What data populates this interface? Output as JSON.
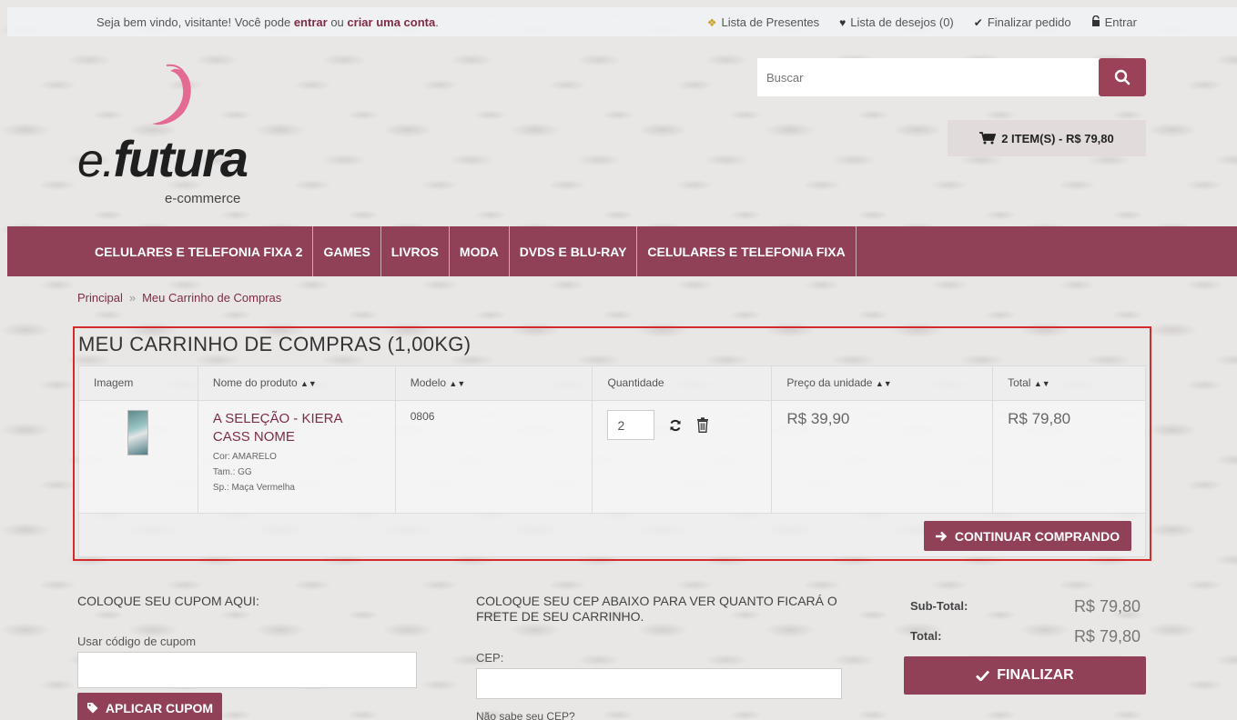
{
  "topbar": {
    "welcome_prefix": "Seja bem vindo, visitante! Você pode",
    "login_link": "entrar",
    "or": "ou",
    "register_link": "criar uma conta",
    "end": ".",
    "links": [
      {
        "icon": "gift-icon",
        "label": "Lista de Presentes"
      },
      {
        "icon": "heart-icon",
        "label": "Lista de desejos (0)"
      },
      {
        "icon": "check-icon",
        "label": "Finalizar pedido"
      },
      {
        "icon": "lock-icon",
        "label": "Entrar"
      }
    ]
  },
  "logo": {
    "brand_prefix": "e.",
    "brand_name": "futura",
    "subtitle": "e-commerce"
  },
  "search": {
    "placeholder": "Buscar"
  },
  "cart_button": {
    "label": "2 ITEM(S) - R$ 79,80"
  },
  "nav": [
    "CELULARES E TELEFONIA FIXA 2",
    "GAMES",
    "LIVROS",
    "MODA",
    "DVDS E BLU-RAY",
    "CELULARES E TELEFONIA FIXA"
  ],
  "breadcrumb": {
    "home": "Principal",
    "separator": "»",
    "current": "Meu Carrinho de Compras"
  },
  "cart": {
    "title": "MEU CARRINHO DE COMPRAS  (1,00KG)",
    "columns": [
      "Imagem",
      "Nome do produto",
      "Modelo",
      "Quantidade",
      "Preço da unidade",
      "Total"
    ],
    "items": [
      {
        "name": "A SELEÇÃO - KIERA CASS NOME",
        "options": [
          "Cor: AMARELO",
          "Tam.: GG",
          "Sp.: Maça Vermelha"
        ],
        "model": "0806",
        "quantity": "2",
        "unit_price": "R$ 39,90",
        "total": "R$ 79,80"
      }
    ],
    "continue_label": "CONTINUAR COMPRANDO"
  },
  "coupon": {
    "title": "COLOQUE SEU CUPOM AQUI:",
    "label": "Usar código de cupom",
    "value": "",
    "button": "APLICAR CUPOM"
  },
  "shipping": {
    "title": "COLOQUE SEU CEP ABAIXO PARA VER QUANTO FICARÁ O FRETE DE SEU CARRINHO.",
    "label": "CEP:",
    "value": "",
    "help": "Não sabe seu CEP?"
  },
  "totals": {
    "subtotal_label": "Sub-Total:",
    "subtotal": "R$ 79,80",
    "total_label": "Total:",
    "total": "R$ 79,80",
    "checkout": "FINALIZAR"
  },
  "colors": {
    "brand": "#914157",
    "highlight_border": "#d42a2a",
    "link": "#7d2d45"
  }
}
